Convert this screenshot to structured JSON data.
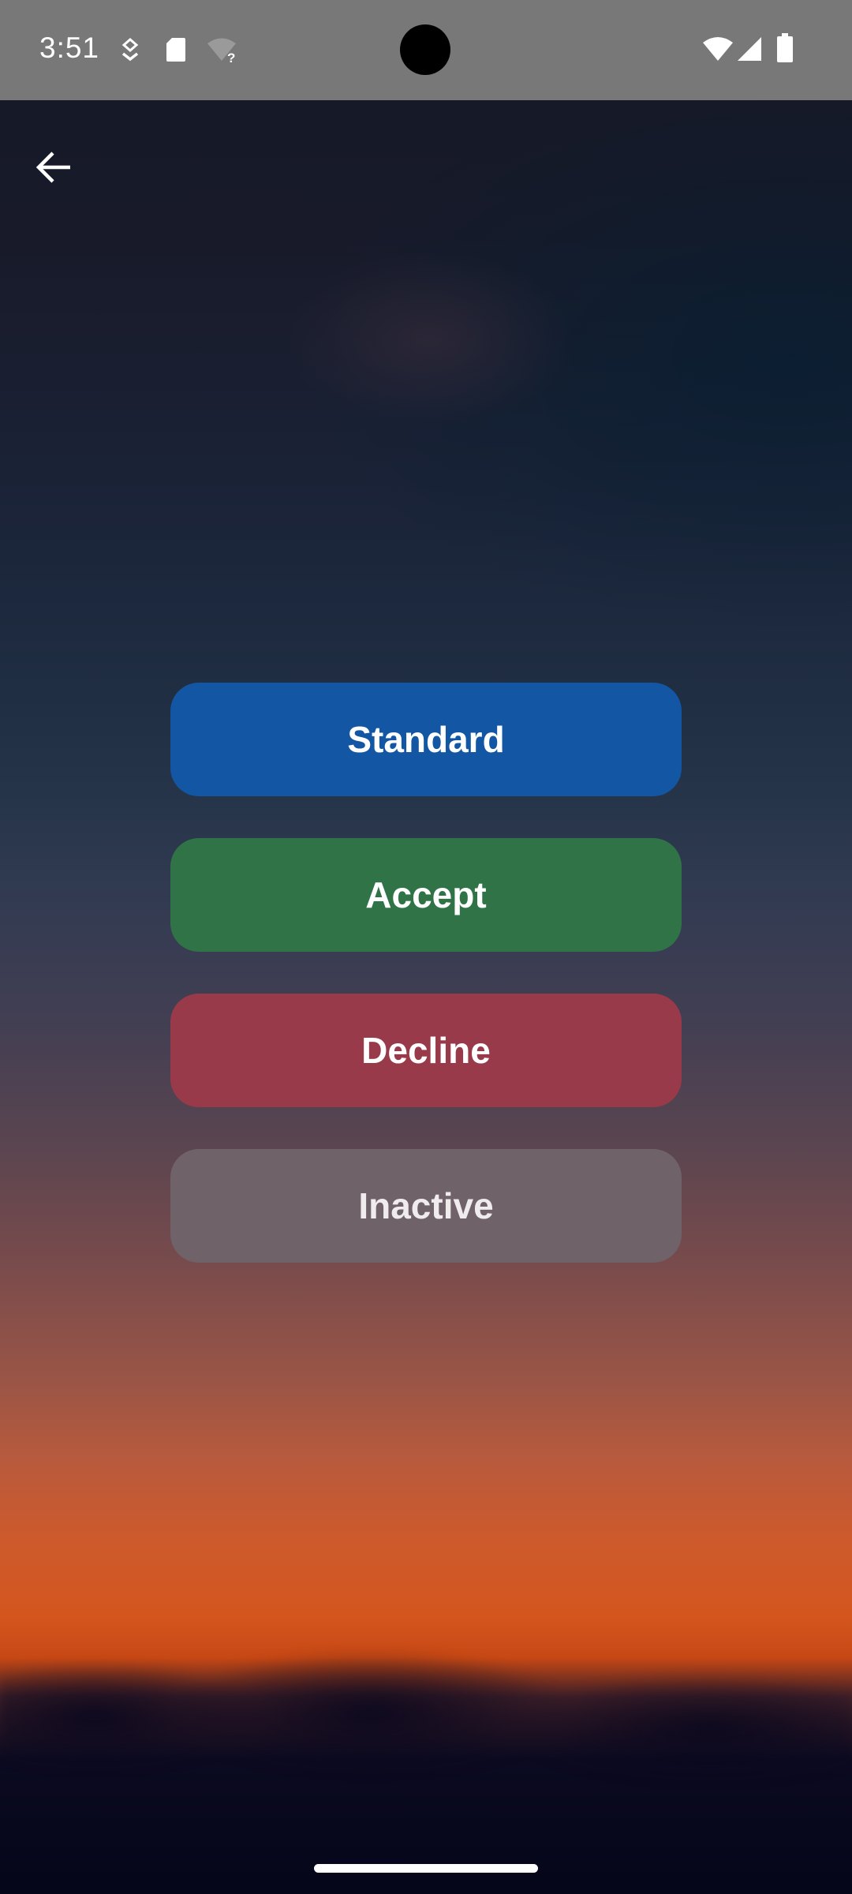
{
  "status_bar": {
    "time": "3:51",
    "icons": [
      "download-icon",
      "sd-card-icon",
      "wifi-unknown-icon",
      "wifi-icon",
      "cellular-signal-icon",
      "battery-icon"
    ]
  },
  "toolbar": {
    "back_icon": "arrow-back-icon"
  },
  "buttons": {
    "standard": {
      "label": "Standard",
      "color": "#1256a4"
    },
    "accept": {
      "label": "Accept",
      "color": "#307347"
    },
    "decline": {
      "label": "Decline",
      "color": "#993a4a"
    },
    "inactive": {
      "label": "Inactive",
      "color": "#6f6262",
      "disabled": true
    }
  }
}
